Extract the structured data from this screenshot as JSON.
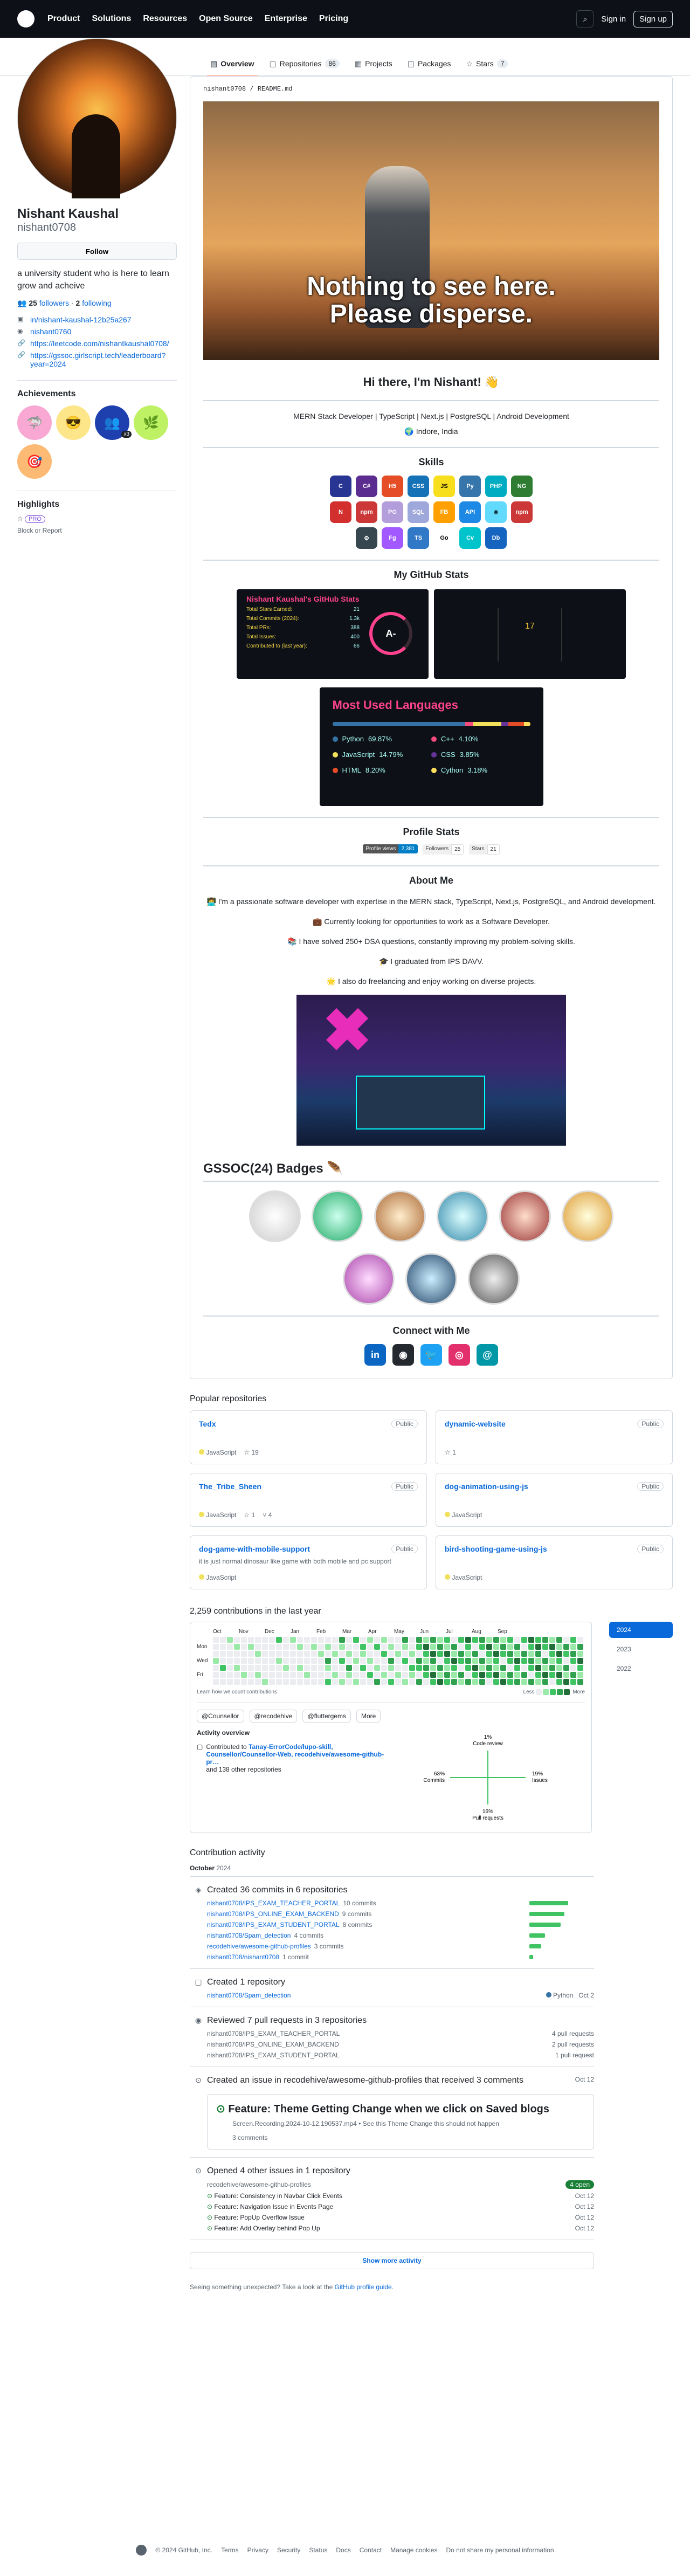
{
  "nav": {
    "items": [
      "Product",
      "Solutions",
      "Resources",
      "Open Source",
      "Enterprise",
      "Pricing"
    ],
    "signin": "Sign in",
    "signup": "Sign up"
  },
  "tabs": [
    {
      "label": "Overview",
      "count": ""
    },
    {
      "label": "Repositories",
      "count": "86"
    },
    {
      "label": "Projects",
      "count": ""
    },
    {
      "label": "Packages",
      "count": ""
    },
    {
      "label": "Stars",
      "count": "7"
    }
  ],
  "profile": {
    "name": "Nishant Kaushal",
    "login": "nishant0708",
    "follow": "Follow",
    "bio": "a university student who is here to learn grow and acheive",
    "followers": "25",
    "followers_label": "followers",
    "following": "2",
    "following_label": "following",
    "links": [
      "in/nishant-kaushal-12b25a267",
      "nishant0760",
      "https://leetcode.com/nishantkaushal0708/",
      "https://gssoc.girlscript.tech/leaderboard?year=2024"
    ]
  },
  "achievements": {
    "title": "Achievements",
    "x_count": "x3"
  },
  "highlights": {
    "title": "Highlights",
    "pro": "PRO",
    "block": "Block or Report"
  },
  "readme": {
    "path": "nishant0708 / README.md",
    "meme_text": [
      "Nothing to see here.",
      "Please disperse."
    ],
    "hi": "Hi there, I'm Nishant! 👋",
    "stack": "MERN Stack Developer | TypeScript | Next.js | PostgreSQL | Android Development",
    "location": "🌍 Indore, India",
    "skills_title": "Skills",
    "stats_title": "My GitHub Stats",
    "profile_stats_title": "Profile Stats",
    "about_title": "About Me",
    "gsoc_title": "GSSOC(24) Badges 🪶",
    "connect_title": "Connect with Me"
  },
  "skills": [
    {
      "t": "C",
      "c": "#283593"
    },
    {
      "t": "C#",
      "c": "#5c2d91"
    },
    {
      "t": "H5",
      "c": "#e44d26"
    },
    {
      "t": "CSS",
      "c": "#1572b6"
    },
    {
      "t": "JS",
      "c": "#f7df1e"
    },
    {
      "t": "Py",
      "c": "#3776ab"
    },
    {
      "t": "PHP",
      "c": "#00acc1"
    },
    {
      "t": "NG",
      "c": "#2e7d32"
    },
    {
      "t": "N",
      "c": "#d32f2f"
    },
    {
      "t": "npm",
      "c": "#cb3837"
    },
    {
      "t": "PG",
      "c": "#b39ddb"
    },
    {
      "t": "SQL",
      "c": "#9fa8da"
    },
    {
      "t": "FB",
      "c": "#ffa000"
    },
    {
      "t": "API",
      "c": "#1e88e5"
    },
    {
      "t": "⚛",
      "c": "#61dafb"
    },
    {
      "t": "npm",
      "c": "#cb3837"
    },
    {
      "t": "⚙",
      "c": "#37474f"
    },
    {
      "t": "Fg",
      "c": "#a259ff"
    },
    {
      "t": "TS",
      "c": "#3178c6"
    },
    {
      "t": "Go",
      "c": "#ffffff"
    },
    {
      "t": "Cv",
      "c": "#00c4cc"
    },
    {
      "t": "Db",
      "c": "#1565c0"
    }
  ],
  "stats_card": {
    "title": "Nishant Kaushal's GitHub Stats",
    "rows": [
      {
        "label": "Total Stars Earned:",
        "value": "21"
      },
      {
        "label": "Total Commits (2024):",
        "value": "1.3k"
      },
      {
        "label": "Total PRs:",
        "value": "388"
      },
      {
        "label": "Total Issues:",
        "value": "400"
      },
      {
        "label": "Contributed to (last year):",
        "value": "66"
      }
    ],
    "grade": "A-",
    "streak": "17"
  },
  "langs": {
    "title": "Most Used Languages",
    "items": [
      {
        "name": "Python",
        "pct": "69.87%",
        "c": "#3572a5",
        "w": 69.87
      },
      {
        "name": "C++",
        "pct": "4.10%",
        "c": "#f34b7d",
        "w": 4.1
      },
      {
        "name": "JavaScript",
        "pct": "14.79%",
        "c": "#f1e05a",
        "w": 14.79
      },
      {
        "name": "CSS",
        "pct": "3.85%",
        "c": "#663399",
        "w": 3.85
      },
      {
        "name": "HTML",
        "pct": "8.20%",
        "c": "#e34c26",
        "w": 8.2
      },
      {
        "name": "Cython",
        "pct": "3.18%",
        "c": "#fedf5b",
        "w": 3.18
      }
    ]
  },
  "profile_stats": {
    "views_l": "Profile views",
    "views_r": "2,381",
    "followers_l": "Followers",
    "followers_r": "25",
    "stars_l": "Stars",
    "stars_r": "21"
  },
  "about": [
    "👨‍💻 I'm a passionate software developer with expertise in the MERN stack, TypeScript, Next.js, PostgreSQL, and Android development.",
    "💼 Currently looking for opportunities to work as a Software Developer.",
    "📚 I have solved 250+ DSA questions, constantly improving my problem-solving skills.",
    "🎓 I graduated from IPS DAVV.",
    "🌟 I also do freelancing and enjoy working on diverse projects."
  ],
  "socials": [
    {
      "t": "in",
      "c": "#0a66c2"
    },
    {
      "t": "◉",
      "c": "#24292f"
    },
    {
      "t": "🐦",
      "c": "#1da1f2"
    },
    {
      "t": "◎",
      "c": "#e1306c"
    },
    {
      "t": "@",
      "c": "#0097a7"
    }
  ],
  "popular": {
    "title": "Popular repositories",
    "repos": [
      {
        "name": "Tedx",
        "desc": "",
        "lang": "JavaScript",
        "stars": "19",
        "forks": ""
      },
      {
        "name": "dynamic-website",
        "desc": "",
        "lang": "",
        "stars": "1",
        "forks": ""
      },
      {
        "name": "The_Tribe_Sheen",
        "desc": "",
        "lang": "JavaScript",
        "stars": "1",
        "forks": "4"
      },
      {
        "name": "dog-animation-using-js",
        "desc": "",
        "lang": "JavaScript",
        "stars": "",
        "forks": ""
      },
      {
        "name": "dog-game-with-mobile-support",
        "desc": "it is just normal dinosaur like game with both mobile and pc support",
        "lang": "JavaScript",
        "stars": "",
        "forks": ""
      },
      {
        "name": "bird-shooting-game-using-js",
        "desc": "",
        "lang": "JavaScript",
        "stars": "",
        "forks": ""
      }
    ],
    "public": "Public"
  },
  "contrib": {
    "title": "2,259 contributions in the last year",
    "months": [
      "Oct",
      "Nov",
      "Dec",
      "Jan",
      "Feb",
      "Mar",
      "Apr",
      "May",
      "Jun",
      "Jul",
      "Aug",
      "Sep"
    ],
    "days": [
      "",
      "Mon",
      "",
      "Wed",
      "",
      "Fri",
      ""
    ],
    "learn": "Learn how we count contributions",
    "less": "Less",
    "more": "More",
    "years": [
      "2024",
      "2023",
      "2022"
    ],
    "orgs": [
      "@Counsellor",
      "@recodehive",
      "@fluttergems"
    ],
    "orgs_more": "More",
    "overview_title": "Activity overview",
    "contributed_prefix": "Contributed to",
    "contributed_repos": "Tanay-ErrorCode/lupo-skill, Counsellor/Counsellor-Web, recodehive/awesome-github-pr…",
    "contributed_suffix": "and 138 other repositories",
    "radar": {
      "code_review": "1%",
      "code_review_l": "Code review",
      "issues": "19%",
      "issues_l": "Issues",
      "pull": "16%",
      "pull_l": "Pull requests",
      "commits": "63%",
      "commits_l": "Commits"
    }
  },
  "activity": {
    "title": "Contribution activity",
    "month": "October",
    "year": "2024",
    "commits": {
      "title": "Created 36 commits in 6 repositories",
      "rows": [
        {
          "repo": "nishant0708/IPS_EXAM_TEACHER_PORTAL",
          "n": "10 commits",
          "w": 60
        },
        {
          "repo": "nishant0708/IPS_ONLINE_EXAM_BACKEND",
          "n": "9 commits",
          "w": 54
        },
        {
          "repo": "nishant0708/IPS_EXAM_STUDENT_PORTAL",
          "n": "8 commits",
          "w": 48
        },
        {
          "repo": "nishant0708/Spam_detection",
          "n": "4 commits",
          "w": 24
        },
        {
          "repo": "recodehive/awesome-github-profiles",
          "n": "3 commits",
          "w": 18
        },
        {
          "repo": "nishant0708/nishant0708",
          "n": "1 commit",
          "w": 6
        }
      ]
    },
    "repo_created": {
      "title": "Created 1 repository",
      "repo": "nishant0708/Spam_detection",
      "lang": "Python",
      "date": "Oct 2"
    },
    "reviews": {
      "title": "Reviewed 7 pull requests in 3 repositories",
      "rows": [
        {
          "repo": "nishant0708/IPS_EXAM_TEACHER_PORTAL",
          "n": "4 pull requests"
        },
        {
          "repo": "nishant0708/IPS_ONLINE_EXAM_BACKEND",
          "n": "2 pull requests"
        },
        {
          "repo": "nishant0708/IPS_EXAM_STUDENT_PORTAL",
          "n": "1 pull request"
        }
      ]
    },
    "issue_created": {
      "title": "Created an issue in recodehive/awesome-github-profiles that received 3 comments",
      "date": "Oct 12",
      "card_title": "Feature: Theme Getting Change when we click on Saved blogs",
      "card_body": "Screen.Recording.2024-10-12.190537.mp4 • See this Theme Change this should not happen",
      "comments": "3 comments"
    },
    "issues_opened": {
      "title": "Opened 4 other issues in 1 repository",
      "repo": "recodehive/awesome-github-profiles",
      "open": "4 open",
      "rows": [
        {
          "t": "Feature: Consistency in Navbar Click Events",
          "d": "Oct 12"
        },
        {
          "t": "Feature: Navigation Issue in Events Page",
          "d": "Oct 12"
        },
        {
          "t": "Feature: PopUp Overflow Issue",
          "d": "Oct 12"
        },
        {
          "t": "Feature: Add Overlay behind Pop Up",
          "d": "Oct 12"
        }
      ]
    },
    "show_more": "Show more activity",
    "feedback_prefix": "Seeing something unexpected? Take a look at the",
    "feedback_link": "GitHub profile guide",
    "feedback_suffix": "."
  },
  "footer": [
    "© 2024 GitHub, Inc.",
    "Terms",
    "Privacy",
    "Security",
    "Status",
    "Docs",
    "Contact",
    "Manage cookies",
    "Do not share my personal information"
  ]
}
